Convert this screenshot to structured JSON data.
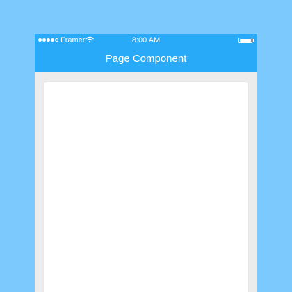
{
  "colors": {
    "background": "#7bc9fd",
    "header": "#29aaf8",
    "screen": "#ececec",
    "page": "#ffffff"
  },
  "status_bar": {
    "carrier": "Framer",
    "time": "8:00 AM",
    "signal_icon": "signal-dots-icon",
    "wifi_icon": "wifi-icon",
    "battery_icon": "battery-icon",
    "signal_strength": "4 of 5",
    "battery_level": 1.0
  },
  "nav": {
    "title": "Page Component"
  }
}
